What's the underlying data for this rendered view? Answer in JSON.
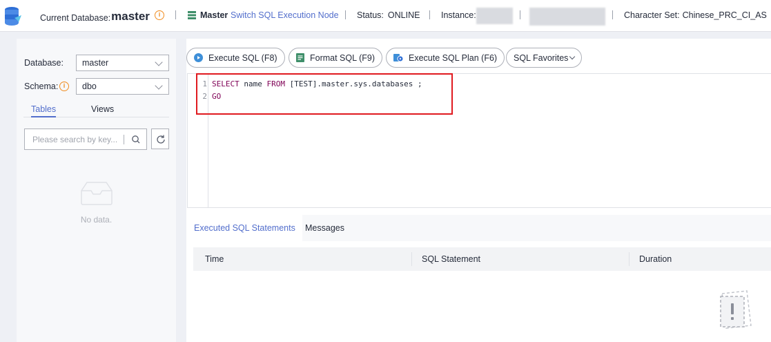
{
  "header": {
    "current_db_label": "Current Database:",
    "current_db_value": "master",
    "node_name": "Master",
    "switch_link": "Switch SQL Execution Node",
    "status_label": "Status:",
    "status_value": "ONLINE",
    "instance_label": "Instance:",
    "charset_label": "Character Set:",
    "charset_value": "Chinese_PRC_CI_AS"
  },
  "sidebar": {
    "database_label": "Database:",
    "database_value": "master",
    "schema_label": "Schema:",
    "schema_value": "dbo",
    "tabs": [
      {
        "label": "Tables"
      },
      {
        "label": "Views"
      }
    ],
    "search_placeholder": "Please search by key...",
    "empty_text": "No data."
  },
  "toolbar": {
    "execute_sql": "Execute SQL (F8)",
    "format_sql": "Format SQL (F9)",
    "execute_plan": "Execute SQL Plan (F6)",
    "favorites": "SQL Favorites"
  },
  "editor": {
    "lines": [
      {
        "num": "1",
        "kw1": "SELECT",
        "t1": " name ",
        "kw2": "FROM",
        "t2": " [TEST].master.sys.databases ;"
      },
      {
        "num": "2",
        "kw1": "GO",
        "t1": "",
        "kw2": "",
        "t2": ""
      }
    ]
  },
  "results": {
    "tabs": [
      {
        "label": "Executed SQL Statements"
      },
      {
        "label": "Messages"
      }
    ],
    "columns": [
      "Time",
      "SQL Statement",
      "Duration"
    ]
  },
  "colors": {
    "accent": "#526ecc",
    "highlight": "#e0191f",
    "warning": "#f08c1f"
  }
}
